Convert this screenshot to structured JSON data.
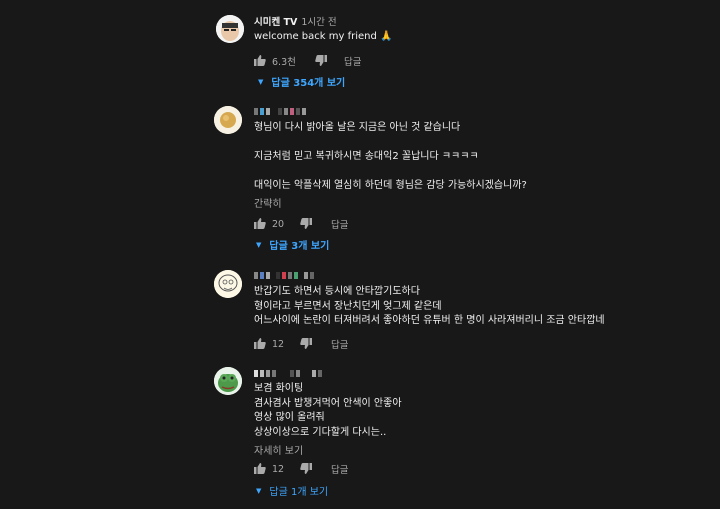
{
  "comments": [
    {
      "author": "시미켄 TV",
      "time": "1시간 전",
      "text": "welcome back my friend 🙏",
      "likes": "6.3천",
      "reply_label": "답글",
      "replies_label": "답글 354개 보기"
    },
    {
      "text": "형님이 다시 밝아올 날은 지금은 아닌 것 같습니다\n\n지금처럼 믿고 복귀하시면 송대익2 꼴납니다 ㅋㅋㅋㅋ\n\n대익이는 악플삭제 열심히 하던데 형님은 감당 가능하시겠습니까?",
      "more": "간략히",
      "likes": "20",
      "reply_label": "답글",
      "replies_label": "답글 3개 보기"
    },
    {
      "text": "반갑기도 하면서 등시에 안타깝기도하다\n형이라고 부르면서 장난치던게 엊그제 같은데\n어느사이에 논란이 터져버려서 좋아하던 유튜버 한 명이 사라져버리니 조금 안타깝네",
      "likes": "12",
      "reply_label": "답글"
    },
    {
      "text": "보겸 화이팅\n겸사겸사 밥챙겨먹어 안색이 안좋아\n영상 많이 올려줘\n상상이상으로 기다할게 다시는..",
      "more": "자세히 보기",
      "likes": "12",
      "reply_label": "답글",
      "replies_label": "답글 1개 보기"
    }
  ],
  "colors": {
    "background": "#181818",
    "text": "#f1f1f1",
    "muted": "#aaaaaa",
    "link": "#3ea6ff"
  }
}
